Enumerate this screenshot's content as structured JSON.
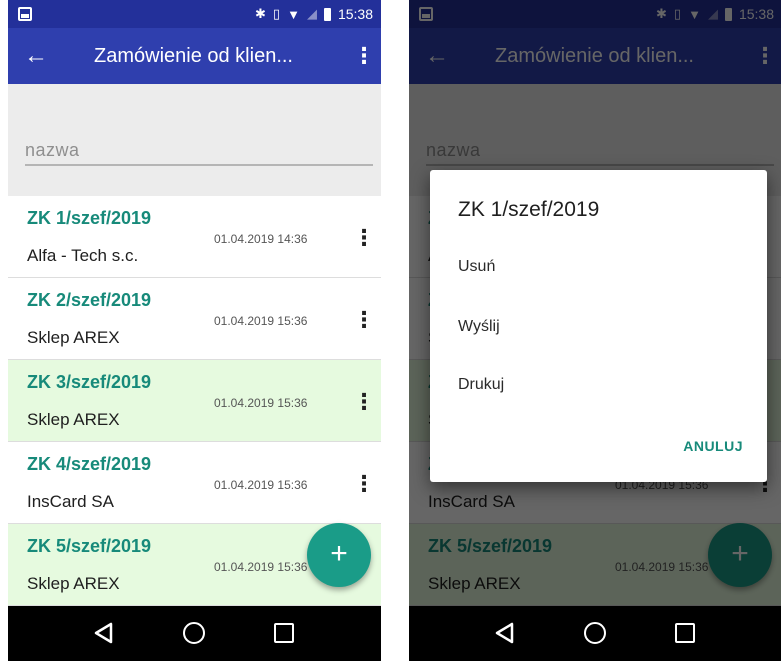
{
  "status_bar": {
    "time": "15:38",
    "icons": [
      "image-icon",
      "bluetooth-icon",
      "vibrate-icon",
      "wifi-icon",
      "no-signal-icon",
      "battery-icon"
    ]
  },
  "app_bar": {
    "title": "Zamówienie od klien...",
    "back_icon": "arrow-back-icon",
    "menu_icon": "more-vert-icon"
  },
  "search": {
    "placeholder": "nazwa",
    "value": ""
  },
  "orders": [
    {
      "number": "ZK 1/szef/2019",
      "client": "Alfa - Tech s.c.",
      "date": "01.04.2019 14:36",
      "highlighted": false
    },
    {
      "number": "ZK 2/szef/2019",
      "client": "Sklep AREX",
      "date": "01.04.2019 15:36",
      "highlighted": false
    },
    {
      "number": "ZK 3/szef/2019",
      "client": "Sklep AREX",
      "date": "01.04.2019 15:36",
      "highlighted": true
    },
    {
      "number": "ZK 4/szef/2019",
      "client": "InsCard SA",
      "date": "01.04.2019 15:36",
      "highlighted": false
    },
    {
      "number": "ZK 5/szef/2019",
      "client": "Sklep AREX",
      "date": "01.04.2019 15:36",
      "highlighted": true
    }
  ],
  "fab": {
    "label": "+"
  },
  "dialog": {
    "title": "ZK 1/szef/2019",
    "options": [
      "Usuń",
      "Wyślij",
      "Drukuj"
    ],
    "cancel_label": "ANULUJ"
  },
  "nav": {
    "icons": [
      "nav-back-icon",
      "nav-home-icon",
      "nav-recent-icon"
    ]
  },
  "colors": {
    "status_bar": "#23309a",
    "app_bar": "#2f3fae",
    "accent": "#178a7a",
    "fab": "#1a9c88",
    "highlight_row": "#e6fadf"
  }
}
